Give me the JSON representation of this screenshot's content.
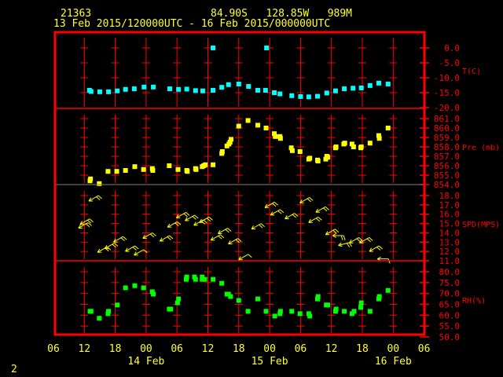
{
  "header": {
    "station": "21363",
    "location": "84.90S   128.85W   989M",
    "period": "13 Feb 2015/120000UTC - 16 Feb 2015/000000UTC"
  },
  "page_number": "2",
  "colors": {
    "frame": "#ff0000",
    "text": "#ffff33",
    "temp": "#00ffff",
    "pressure": "#ffff00",
    "wind": "#ffff00",
    "rh": "#00ff00",
    "grid_alt": "#808080"
  },
  "chart_data": [
    {
      "type": "scatter",
      "title": "Temperature",
      "ylabel": "T(C)",
      "x_units": "hours since 13 Feb 06 UTC",
      "xlim": [
        0,
        72
      ],
      "ylim": [
        -20,
        0
      ],
      "yticks": [
        "0.0",
        "-5.0",
        "-10.0",
        "-15.0",
        "-20.0"
      ],
      "ytick_values": [
        0,
        -5,
        -10,
        -15,
        -20
      ],
      "points": [
        [
          7.0,
          -14.2
        ],
        [
          7.3,
          -14.6
        ],
        [
          9.0,
          -14.7
        ],
        [
          10.7,
          -14.7
        ],
        [
          12.4,
          -14.4
        ],
        [
          14.0,
          -13.9
        ],
        [
          15.7,
          -13.7
        ],
        [
          17.6,
          -13.1
        ],
        [
          19.4,
          -13.1
        ],
        [
          22.6,
          -13.7
        ],
        [
          24.3,
          -13.9
        ],
        [
          25.9,
          -13.8
        ],
        [
          27.6,
          -14.3
        ],
        [
          29.0,
          -14.4
        ],
        [
          31.0,
          -14.2
        ],
        [
          32.7,
          -13.2
        ],
        [
          34.0,
          -12.3
        ],
        [
          36.0,
          -12.1
        ],
        [
          37.9,
          -12.9
        ],
        [
          39.7,
          -14.2
        ],
        [
          41.2,
          -14.2
        ],
        [
          42.9,
          -15.0
        ],
        [
          44.0,
          -15.4
        ],
        [
          46.3,
          -16.0
        ],
        [
          48.0,
          -16.3
        ],
        [
          49.6,
          -16.4
        ],
        [
          51.3,
          -16.2
        ],
        [
          53.1,
          -15.1
        ],
        [
          54.8,
          -14.4
        ],
        [
          56.5,
          -13.7
        ],
        [
          58.2,
          -13.5
        ],
        [
          59.8,
          -13.4
        ],
        [
          61.5,
          -12.6
        ],
        [
          63.2,
          -11.8
        ],
        [
          65.0,
          -12.1
        ],
        [
          31.0,
          0.0
        ],
        [
          41.4,
          0.0
        ]
      ]
    },
    {
      "type": "scatter",
      "title": "Pressure",
      "ylabel": "Pre (mb)",
      "xlim": [
        0,
        72
      ],
      "ylim": [
        854,
        861
      ],
      "yticks": [
        "861.0",
        "860.0",
        "859.0",
        "858.0",
        "857.0",
        "856.0",
        "855.0",
        "854.0"
      ],
      "ytick_values": [
        861,
        860,
        859,
        858,
        857,
        856,
        855,
        854
      ],
      "points": [
        [
          7.1,
          854.4
        ],
        [
          7.2,
          854.6
        ],
        [
          8.9,
          854.1
        ],
        [
          10.6,
          855.4
        ],
        [
          12.3,
          855.4
        ],
        [
          14.0,
          855.5
        ],
        [
          15.8,
          855.9
        ],
        [
          17.5,
          855.6
        ],
        [
          19.2,
          855.7
        ],
        [
          19.3,
          855.5
        ],
        [
          22.5,
          856.0
        ],
        [
          24.2,
          855.6
        ],
        [
          25.9,
          855.5
        ],
        [
          26.0,
          855.4
        ],
        [
          27.6,
          855.7
        ],
        [
          27.7,
          855.6
        ],
        [
          28.9,
          855.9
        ],
        [
          29.2,
          856.0
        ],
        [
          29.5,
          856.1
        ],
        [
          31.0,
          856.1
        ],
        [
          32.7,
          857.3
        ],
        [
          32.8,
          857.5
        ],
        [
          33.7,
          858.1
        ],
        [
          34.1,
          858.3
        ],
        [
          34.3,
          858.5
        ],
        [
          34.5,
          858.8
        ],
        [
          36.0,
          860.2
        ],
        [
          37.8,
          860.8
        ],
        [
          39.7,
          860.3
        ],
        [
          41.3,
          860.0
        ],
        [
          42.9,
          859.4
        ],
        [
          43.1,
          859.1
        ],
        [
          44.0,
          859.1
        ],
        [
          44.1,
          858.9
        ],
        [
          46.2,
          857.9
        ],
        [
          46.4,
          857.6
        ],
        [
          47.9,
          857.5
        ],
        [
          49.6,
          856.7
        ],
        [
          49.8,
          856.8
        ],
        [
          51.3,
          856.6
        ],
        [
          51.4,
          856.5
        ],
        [
          52.9,
          856.7
        ],
        [
          53.1,
          857.0
        ],
        [
          53.3,
          856.9
        ],
        [
          54.8,
          857.9
        ],
        [
          54.9,
          858.0
        ],
        [
          56.4,
          858.3
        ],
        [
          56.6,
          858.4
        ],
        [
          58.0,
          858.3
        ],
        [
          58.3,
          858.0
        ],
        [
          59.7,
          857.9
        ],
        [
          59.8,
          858.0
        ],
        [
          61.5,
          858.4
        ],
        [
          63.2,
          859.2
        ],
        [
          63.3,
          858.9
        ],
        [
          65.0,
          860.0
        ]
      ]
    },
    {
      "type": "scatter",
      "title": "Wind speed and direction",
      "ylabel": "SPD(MPS)",
      "xlim": [
        0,
        72
      ],
      "ylim": [
        11,
        18
      ],
      "yticks": [
        "18.0",
        "17.0",
        "16.0",
        "15.0",
        "14.0",
        "13.0",
        "12.0",
        "11.0"
      ],
      "ytick_values": [
        18,
        17,
        16,
        15,
        14,
        13,
        12,
        11
      ],
      "points": [
        [
          5.8,
          14.8,
          60
        ],
        [
          6.1,
          15.2,
          60
        ],
        [
          7.8,
          17.7,
          60
        ],
        [
          9.5,
          12.2,
          60
        ],
        [
          10.9,
          12.6,
          60
        ],
        [
          12.6,
          13.3,
          60
        ],
        [
          14.9,
          12.3,
          60
        ],
        [
          16.6,
          11.9,
          60
        ],
        [
          18.3,
          13.7,
          60
        ],
        [
          21.6,
          13.4,
          60
        ],
        [
          23.1,
          14.9,
          60
        ],
        [
          24.8,
          15.9,
          60
        ],
        [
          26.5,
          15.6,
          60
        ],
        [
          28.2,
          15.1,
          60
        ],
        [
          29.3,
          15.4,
          60
        ],
        [
          31.5,
          13.5,
          60
        ],
        [
          32.9,
          14.2,
          60
        ],
        [
          34.9,
          13.1,
          60
        ],
        [
          36.9,
          11.4,
          60
        ],
        [
          39.4,
          14.7,
          60
        ],
        [
          42.0,
          17.0,
          60
        ],
        [
          43.1,
          16.2,
          60
        ],
        [
          45.9,
          15.8,
          60
        ],
        [
          48.8,
          17.5,
          60
        ],
        [
          50.5,
          15.4,
          60
        ],
        [
          51.9,
          16.5,
          60
        ],
        [
          53.8,
          14.1,
          60
        ],
        [
          55.3,
          13.7,
          90
        ],
        [
          56.4,
          12.8,
          75
        ],
        [
          58.4,
          13.2,
          60
        ],
        [
          60.4,
          13.2,
          60
        ],
        [
          62.3,
          12.3,
          60
        ],
        [
          64.0,
          11.2,
          90
        ]
      ]
    },
    {
      "type": "scatter",
      "title": "Relative humidity",
      "ylabel": "RH(%)",
      "xlim": [
        0,
        72
      ],
      "ylim": [
        50,
        80
      ],
      "yticks": [
        "80.0",
        "75.0",
        "70.0",
        "65.0",
        "60.0",
        "55.0",
        "50.0"
      ],
      "ytick_values": [
        80,
        75,
        70,
        65,
        60,
        55,
        50
      ],
      "points": [
        [
          7.1,
          61.8
        ],
        [
          7.3,
          61.8
        ],
        [
          8.9,
          58.6
        ],
        [
          10.6,
          60.7
        ],
        [
          10.7,
          61.8
        ],
        [
          12.4,
          64.7
        ],
        [
          14.0,
          72.6
        ],
        [
          15.8,
          73.6
        ],
        [
          17.5,
          72.6
        ],
        [
          19.2,
          70.8
        ],
        [
          19.4,
          69.7
        ],
        [
          22.5,
          62.8
        ],
        [
          22.8,
          62.8
        ],
        [
          24.1,
          65.7
        ],
        [
          24.3,
          67.5
        ],
        [
          25.8,
          76.5
        ],
        [
          25.9,
          77.6
        ],
        [
          27.4,
          77.6
        ],
        [
          27.6,
          76.5
        ],
        [
          28.9,
          77.6
        ],
        [
          28.9,
          76.5
        ],
        [
          29.4,
          76.5
        ],
        [
          31.0,
          76.5
        ],
        [
          32.7,
          74.7
        ],
        [
          33.7,
          69.7
        ],
        [
          34.0,
          69.7
        ],
        [
          34.4,
          68.6
        ],
        [
          36.0,
          66.8
        ],
        [
          37.8,
          61.8
        ],
        [
          39.7,
          67.5
        ],
        [
          41.3,
          61.8
        ],
        [
          43.0,
          59.6
        ],
        [
          44.0,
          60.7
        ],
        [
          44.1,
          61.8
        ],
        [
          46.3,
          61.8
        ],
        [
          47.9,
          60.7
        ],
        [
          49.6,
          60.7
        ],
        [
          49.8,
          59.6
        ],
        [
          51.3,
          67.5
        ],
        [
          51.4,
          68.6
        ],
        [
          53.0,
          64.7
        ],
        [
          53.3,
          64.7
        ],
        [
          54.8,
          61.8
        ],
        [
          54.9,
          62.8
        ],
        [
          56.5,
          61.8
        ],
        [
          58.0,
          60.7
        ],
        [
          58.4,
          61.8
        ],
        [
          59.7,
          63.6
        ],
        [
          59.8,
          65.7
        ],
        [
          61.5,
          61.8
        ],
        [
          63.2,
          67.5
        ],
        [
          63.3,
          68.6
        ],
        [
          65.0,
          71.4
        ]
      ]
    }
  ],
  "x_axis": {
    "ticks": [
      "06",
      "12",
      "18",
      "00",
      "06",
      "12",
      "18",
      "00",
      "06",
      "12",
      "18",
      "00",
      "06"
    ],
    "tick_hours": [
      0,
      6,
      12,
      18,
      24,
      30,
      36,
      42,
      48,
      54,
      60,
      66,
      72
    ],
    "dates": [
      {
        "label": "14 Feb",
        "hour": 18
      },
      {
        "label": "15 Feb",
        "hour": 42
      },
      {
        "label": "16 Feb",
        "hour": 66
      }
    ]
  }
}
